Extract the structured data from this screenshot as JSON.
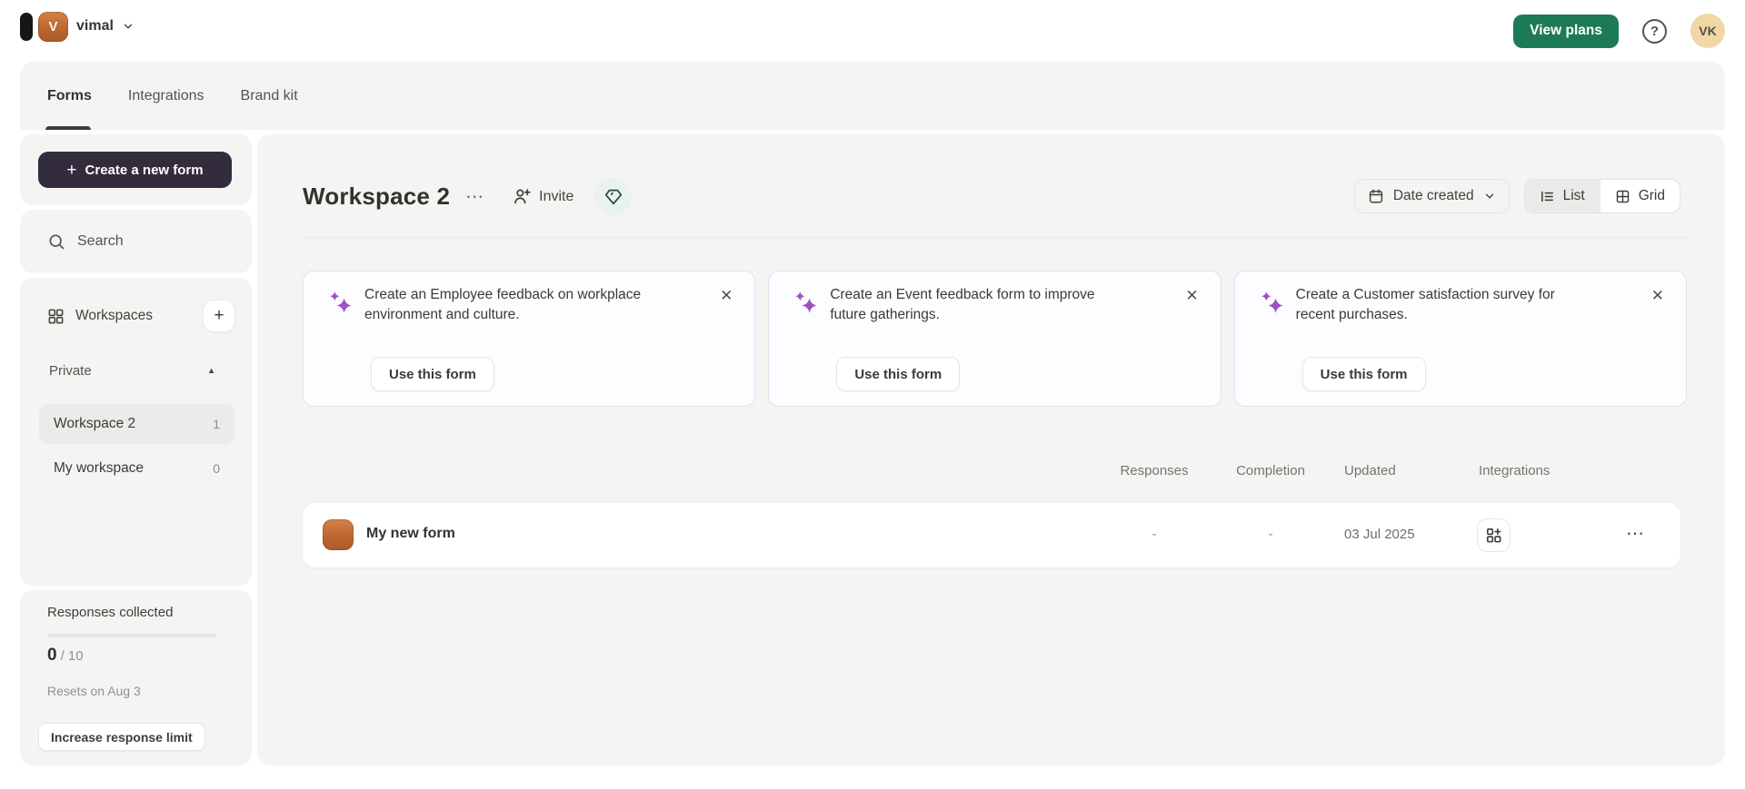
{
  "topbar": {
    "workspace_name": "vimal",
    "view_plans_label": "View plans",
    "user_initials": "VK",
    "workspace_initial": "V"
  },
  "tabs": {
    "items": [
      "Forms",
      "Integrations",
      "Brand kit"
    ],
    "active": "Forms"
  },
  "sidebar": {
    "create_button_label": "Create a new form",
    "search_label": "Search",
    "workspaces_label": "Workspaces",
    "private_group_label": "Private",
    "items": [
      {
        "label": "Workspace 2",
        "count": "1",
        "active": true
      },
      {
        "label": "My workspace",
        "count": "0",
        "active": false
      }
    ],
    "usage": {
      "title": "Responses collected",
      "used": "0",
      "limit": "/ 10",
      "resets": "Resets on Aug 3",
      "increase_button_label": "Increase response limit",
      "progress_percent": 0
    }
  },
  "main": {
    "title": "Workspace 2",
    "invite_label": "Invite",
    "sort_label": "Date created",
    "view_toggle": {
      "list_label": "List",
      "grid_label": "Grid",
      "active": "List"
    },
    "suggestions": [
      {
        "text": "Create an Employee feedback on workplace environment and culture.",
        "button": "Use this form"
      },
      {
        "text": "Create an Event feedback form to improve future gatherings.",
        "button": "Use this form"
      },
      {
        "text": "Create a Customer satisfaction survey for recent purchases.",
        "button": "Use this form"
      }
    ],
    "table": {
      "columns": [
        "Responses",
        "Completion",
        "Updated",
        "Integrations"
      ],
      "rows": [
        {
          "name": "My new form",
          "responses": "-",
          "completion": "-",
          "updated": "03 Jul 2025"
        }
      ]
    }
  },
  "icons": {
    "close": "✕",
    "more_horizontal": "⋯",
    "plus": "+",
    "collapse_triangle": "▲",
    "help": "?"
  },
  "colors": {
    "accent_green": "#1D7A57",
    "brand_dark": "#322C3C",
    "sparkle_purple": "#A14FC4",
    "avatar_orange": "#BC6730",
    "panel_gray": "#F4F4F3",
    "card_border_purple": "#E8DDF3"
  }
}
